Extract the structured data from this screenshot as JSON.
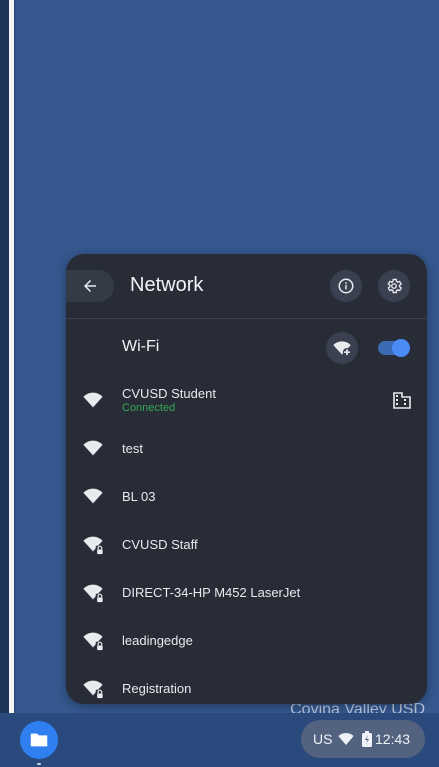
{
  "panel": {
    "title": "Network",
    "wifi_label": "Wi-Fi",
    "wifi_enabled": true,
    "networks": [
      {
        "name": "CVUSD Student",
        "status": "Connected",
        "secured": false,
        "enterprise": true
      },
      {
        "name": "test",
        "status": "",
        "secured": false,
        "enterprise": false
      },
      {
        "name": "BL 03",
        "status": "",
        "secured": false,
        "enterprise": false
      },
      {
        "name": "CVUSD Staff",
        "status": "",
        "secured": true,
        "enterprise": false
      },
      {
        "name": "DIRECT-34-HP M452 LaserJet",
        "status": "",
        "secured": true,
        "enterprise": false
      },
      {
        "name": "leadingedge",
        "status": "",
        "secured": true,
        "enterprise": false
      },
      {
        "name": "Registration",
        "status": "",
        "secured": true,
        "enterprise": false
      }
    ]
  },
  "wallpaper": {
    "text": "Covina Valley USD"
  },
  "shelf": {
    "keyboard_layout": "US",
    "time": "12:43"
  },
  "colors": {
    "accent": "#4a8bf5",
    "connected": "#34a853",
    "panel_bg": "#282c37"
  }
}
